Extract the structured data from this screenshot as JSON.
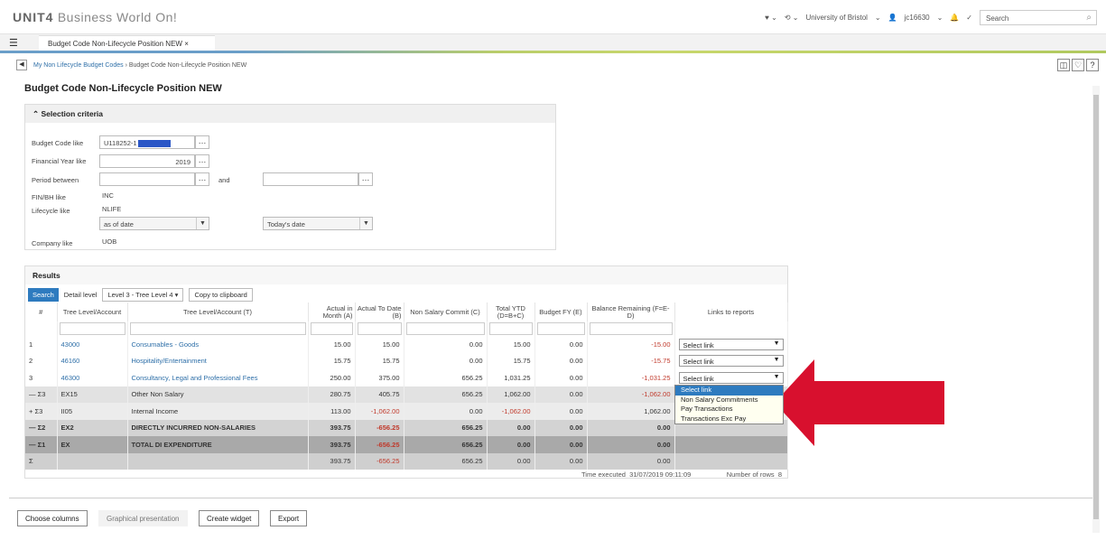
{
  "app": {
    "brand": "UNIT4",
    "product": "Business World On!"
  },
  "topbar": {
    "heart_icon": "heart-icon",
    "history_icon": "history-icon",
    "org": "University of Bristol",
    "user": "jc16630",
    "search_placeholder": "Search"
  },
  "tabs": [
    {
      "label": "Budget Code Non-Lifecycle Position NEW",
      "close": "×"
    }
  ],
  "breadcrumb": {
    "parent": "My Non Lifecycle Budget Codes",
    "sep": "›",
    "current": "Budget Code Non-Lifecycle Position NEW"
  },
  "page_title": "Budget Code Non-Lifecycle Position NEW",
  "selection": {
    "title": "Selection criteria",
    "budget_code_label": "Budget Code like",
    "budget_code_value": "U118252-1",
    "financial_year_label": "Financial Year like",
    "financial_year_value": "2019",
    "period_label": "Period between",
    "and_label": "and",
    "finbh_label": "FIN/BH like",
    "finbh_value": "INC",
    "lifecycle_label": "Lifecycle like",
    "lifecycle_value": "NLIFE",
    "as_of_date": "as of date",
    "todays_date": "Today's date",
    "company_label": "Company like",
    "company_value": "UOB"
  },
  "results": {
    "title": "Results",
    "search_btn": "Search",
    "detail_level_label": "Detail level",
    "detail_level_value": "Level 3 - Tree Level 4",
    "copy_btn": "Copy to clipboard",
    "columns": [
      "#",
      "Tree Level/Account",
      "Tree Level/Account (T)",
      "Actual in Month (A)",
      "Actual To Date (B)",
      "Non Salary Commit (C)",
      "Total YTD (D=B+C)",
      "Budget FY (E)",
      "Balance Remaining (F=E-D)",
      "Links to reports"
    ],
    "rows": [
      {
        "c0": "1",
        "c1": "43000",
        "c2": "Consumables - Goods",
        "a": "15.00",
        "b": "15.00",
        "c": "0.00",
        "d": "15.00",
        "e": "0.00",
        "f": "-15.00",
        "link": "Select link"
      },
      {
        "c0": "2",
        "c1": "46160",
        "c2": "Hospitality/Entertainment",
        "a": "15.75",
        "b": "15.75",
        "c": "0.00",
        "d": "15.75",
        "e": "0.00",
        "f": "-15.75",
        "link": "Select link"
      },
      {
        "c0": "3",
        "c1": "46300",
        "c2": "Consultancy, Legal and Professional Fees",
        "a": "250.00",
        "b": "375.00",
        "c": "656.25",
        "d": "1,031.25",
        "e": "0.00",
        "f": "-1,031.25",
        "link": "Select link"
      },
      {
        "c0": "— Σ3",
        "c1": "EX15",
        "c2": "Other Non Salary",
        "a": "280.75",
        "b": "405.75",
        "c": "656.25",
        "d": "1,062.00",
        "e": "0.00",
        "f": "-1,062.00"
      },
      {
        "c0": "+ Σ3",
        "c1": "II05",
        "c2": "Internal Income",
        "a": "113.00",
        "b": "-1,062.00",
        "c": "0.00",
        "d": "-1,062.00",
        "e": "0.00",
        "f": "1,062.00"
      },
      {
        "c0": "— Σ2",
        "c1": "EX2",
        "c2": "DIRECTLY INCURRED NON-SALARIES",
        "a": "393.75",
        "b": "-656.25",
        "c": "656.25",
        "d": "0.00",
        "e": "0.00",
        "f": "0.00"
      },
      {
        "c0": "— Σ1",
        "c1": "EX",
        "c2": "TOTAL DI EXPENDITURE",
        "a": "393.75",
        "b": "-656.25",
        "c": "656.25",
        "d": "0.00",
        "e": "0.00",
        "f": "0.00"
      },
      {
        "c0": "Σ",
        "c1": "",
        "c2": "",
        "a": "393.75",
        "b": "-656.25",
        "c": "656.25",
        "d": "0.00",
        "e": "0.00",
        "f": "0.00"
      }
    ],
    "link_options": [
      "Select link",
      "Non Salary Commitments",
      "Pay Transactions",
      "Transactions Exc Pay"
    ],
    "time_executed_label": "Time executed",
    "time_executed_value": "31/07/2019 09:11:09",
    "num_rows_label": "Number of rows",
    "num_rows_value": "8"
  },
  "bottom": {
    "choose_columns": "Choose columns",
    "graphical": "Graphical presentation",
    "create_widget": "Create widget",
    "export": "Export"
  },
  "colors": {
    "accent_blue": "#2e7bbf",
    "negative_red": "#c0392b",
    "arrow_red": "#d8102e"
  }
}
